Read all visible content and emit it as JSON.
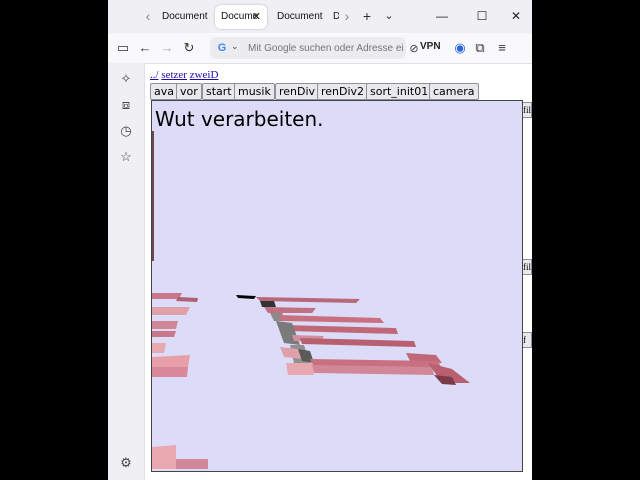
{
  "browser": {
    "tabs": [
      {
        "label": "Document",
        "active": false
      },
      {
        "label": "Docume",
        "active": true
      },
      {
        "label": "Document",
        "active": false
      },
      {
        "label": "D",
        "active": false
      }
    ],
    "address_placeholder": "Mit Google suchen oder Adresse eingeben",
    "vpn_label": "VPN",
    "icons": [
      "back-icon",
      "forward-icon",
      "reload-icon",
      "extensions-icon",
      "menu-icon",
      "account-icon"
    ]
  },
  "page": {
    "links": [
      "../",
      "setzer",
      "zweiD"
    ],
    "buttons": [
      "ava",
      "vor",
      "start",
      "musik",
      "renDiv",
      "renDiv2",
      "sort_init01",
      "camera"
    ],
    "side_fragments": [
      "fil",
      "fil",
      "f"
    ],
    "canvas_text": "Wut verarbeiten.",
    "canvas_background": "#dcdcf8",
    "tile_colors": [
      "#e8a0a8",
      "#c06878",
      "#808080",
      "#000000"
    ]
  }
}
